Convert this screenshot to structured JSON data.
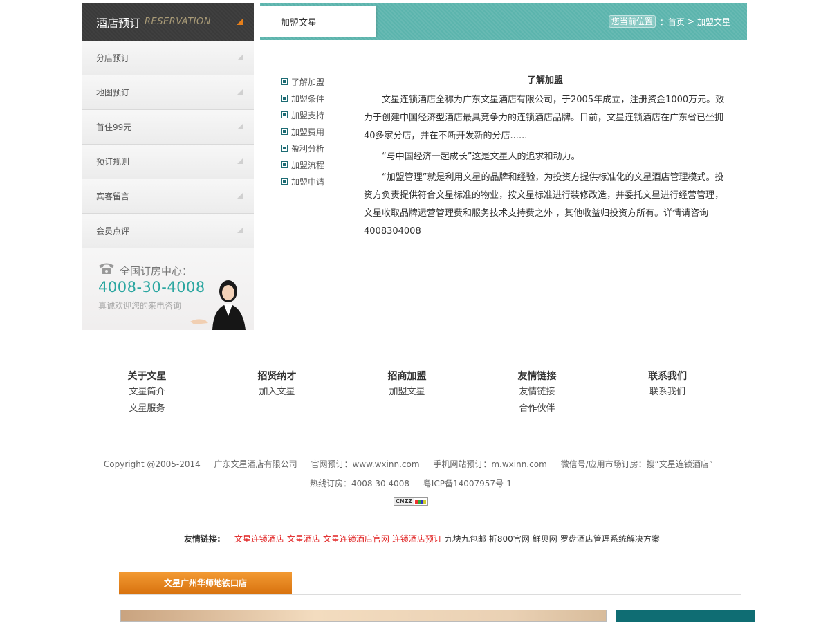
{
  "sidebar": {
    "title": "酒店预订",
    "subtitle": "RESERVATION",
    "items": [
      {
        "label": "分店预订"
      },
      {
        "label": "地图预订"
      },
      {
        "label": "首住99元"
      },
      {
        "label": "预订规则"
      },
      {
        "label": "宾客留言"
      },
      {
        "label": "会员点评"
      }
    ],
    "hotline_label": "全国订房中心：",
    "hotline_number": "4008-30-4008",
    "hotline_welcome": "真诚欢迎您的来电咨询"
  },
  "header": {
    "tab_label": "加盟文星",
    "breadcrumb_prefix": "您当前位置",
    "breadcrumb_home": "：首页",
    "breadcrumb_sep": ">",
    "breadcrumb_current": "加盟文星"
  },
  "submenu": [
    {
      "label": "了解加盟"
    },
    {
      "label": "加盟条件"
    },
    {
      "label": "加盟支持"
    },
    {
      "label": "加盟费用"
    },
    {
      "label": "盈利分析"
    },
    {
      "label": "加盟流程"
    },
    {
      "label": "加盟申请"
    }
  ],
  "article": {
    "title": "了解加盟",
    "p1": "文星连锁酒店全称为广东文星酒店有限公司，于2005年成立，注册资金1000万元。致力于创建中国经济型酒店最具竞争力的连锁酒店品牌。目前，文星连锁酒店在广东省已坐拥40多家分店，并在不断开发新的分店......",
    "p2": "“与中国经济一起成长”这是文星人的追求和动力。",
    "p3": "“加盟管理”就是利用文星的品牌和经验，为投资方提供标准化的文星酒店管理模式。投资方负责提供符合文星标准的物业，按文星标准进行装修改造，并委托文星进行经营管理，文星收取品牌运营管理费和服务技术支持费之外 ，其他收益归投资方所有。详情请咨询 4008304008"
  },
  "footer": {
    "columns": [
      {
        "head": "关于文星",
        "links": [
          "文星简介",
          "文星服务"
        ]
      },
      {
        "head": "招贤纳才",
        "links": [
          "加入文星"
        ]
      },
      {
        "head": "招商加盟",
        "links": [
          "加盟文星"
        ]
      },
      {
        "head": "友情链接",
        "links": [
          "友情链接",
          "合作伙伴"
        ]
      },
      {
        "head": "联系我们",
        "links": [
          "联系我们"
        ]
      }
    ],
    "copyright": "Copyright @2005-2014",
    "company": "广东文星酒店有限公司",
    "website": "官网预订：www.wxinn.com",
    "mobile": "手机网站预订：m.wxinn.com",
    "wechat": "微信号/应用市场订房：搜“文星连锁酒店”",
    "hotline": "热线订房：4008 30 4008",
    "icp": "粤ICP备14007957号-1",
    "cnzz": "CNZZ",
    "friends_label": "友情链接:",
    "friends_red": [
      "文星连锁酒店",
      "文星酒店",
      "文星连锁酒店官网",
      "连锁酒店预订"
    ],
    "friends_black": [
      "九块九包邮",
      "折800官网",
      "鲜贝网",
      "罗盘酒店管理系统解决方案"
    ]
  },
  "store": {
    "tab_label": "文星广州华师地铁口店"
  },
  "colors": {
    "teal": "#5bb4ad",
    "dark_teal": "#0f6d73",
    "orange": "#e57f1b",
    "link_red": "#e02020"
  }
}
